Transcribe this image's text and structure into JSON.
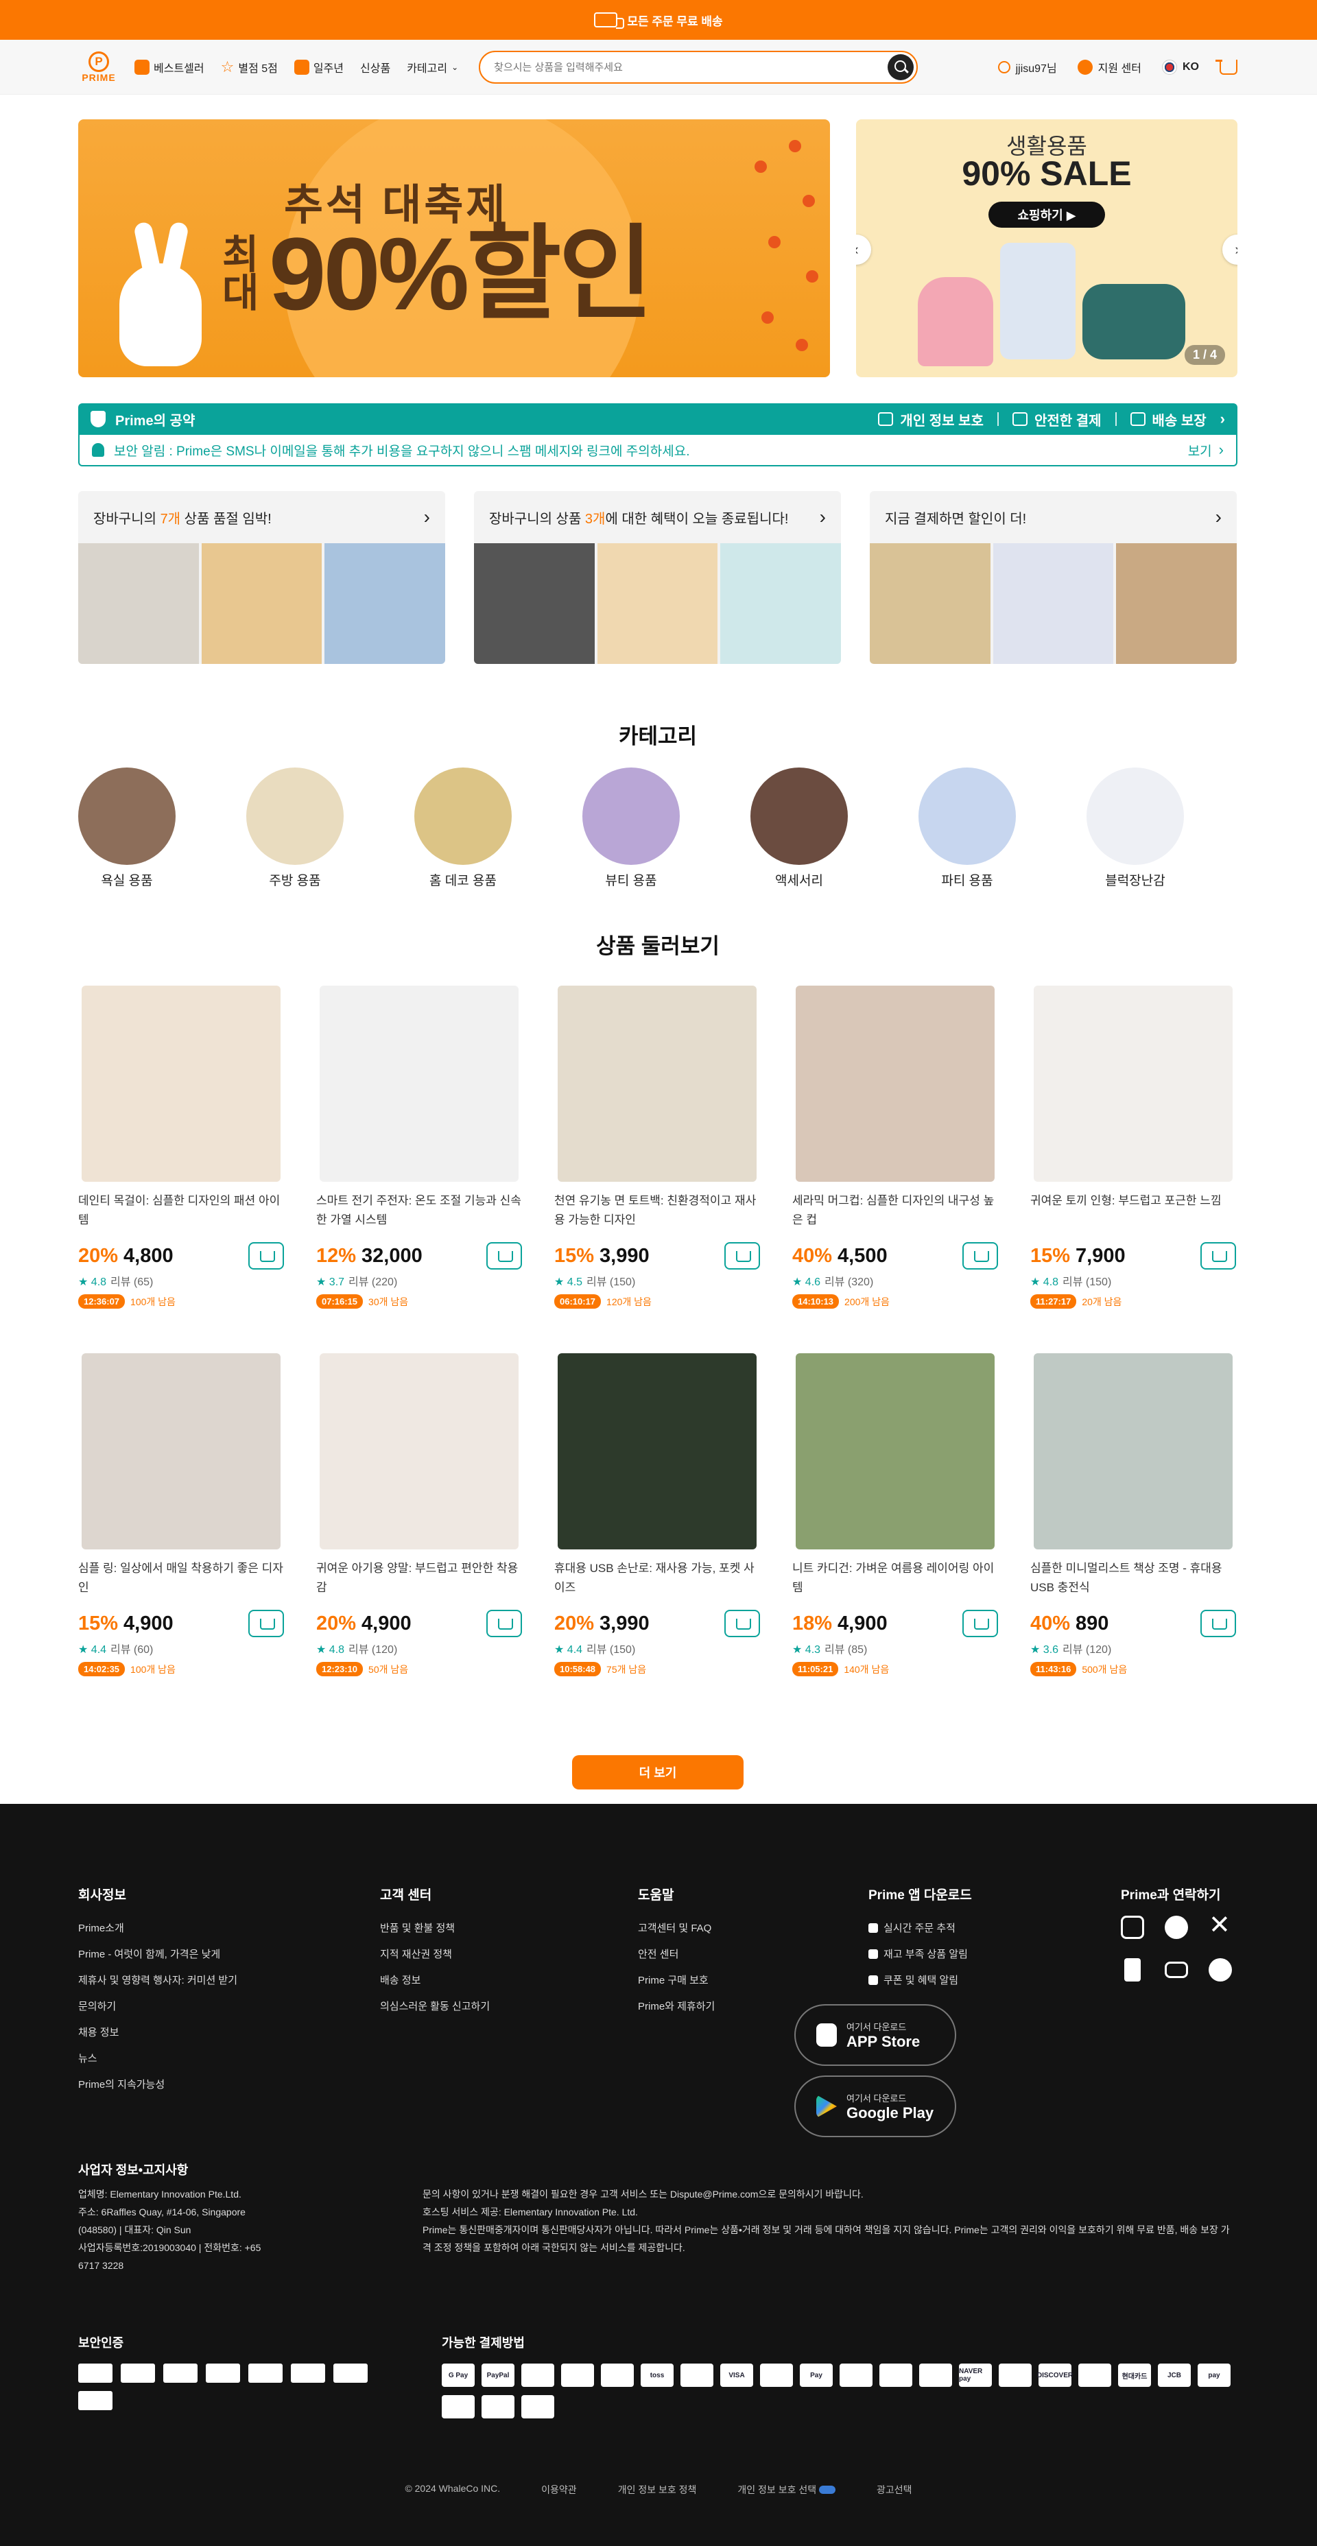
{
  "topbar": {
    "text": "모든 주문 무료 배송"
  },
  "header": {
    "logo_text": "PRIME",
    "logo_letter": "P",
    "nav": [
      {
        "label": "베스트셀러",
        "icon": "thumbs-up-icon"
      },
      {
        "label": "별점 5점",
        "icon": "star-icon"
      },
      {
        "label": "일주년",
        "icon": "store-icon"
      },
      {
        "label": "신상품"
      },
      {
        "label": "카테고리"
      }
    ],
    "search_placeholder": "찾으시는 상품을 입력해주세요",
    "user": "jjisu97님",
    "support": "지원 센터",
    "lang": "KO"
  },
  "hero": {
    "main_title": "추석 대축제",
    "main_small": "최대",
    "main_big": "90%할인",
    "side_sub": "생활용품",
    "side_title": "90% SALE",
    "side_button": "쇼핑하기 ▶",
    "pager": "1 / 4"
  },
  "promise": {
    "title": "Prime의 공약",
    "items": [
      "개인 정보 보호",
      "안전한 결제",
      "배송 보장"
    ],
    "notice": "보안 알림 : Prime은 SMS나 이메일을 통해 추가 비용을 요구하지 않으니 스팸 메세지와 링크에 주의하세요.",
    "notice_more": "보기"
  },
  "cards": [
    {
      "pre": "장바구니의 ",
      "hl": "7개",
      "post": " 상품 품절 임박!"
    },
    {
      "pre": "장바구니의 상품 ",
      "hl": "3개",
      "post": "에 대한 혜택이 오늘 종료됩니다!"
    },
    {
      "pre": "지금 결제하면 할인이 더!",
      "hl": "",
      "post": ""
    }
  ],
  "categories_title": "카테고리",
  "categories": [
    "욕실 용품",
    "주방 용품",
    "홈 데코 용품",
    "뷰티 용품",
    "액세서리",
    "파티 용품",
    "블럭장난감"
  ],
  "products_title": "상품 둘러보기",
  "products": [
    {
      "name": "데인티 목걸이: 심플한 디자인의 패션 아이템",
      "discount": "20%",
      "price": "4,800",
      "rating": "4.8",
      "reviews": "리뷰 (65)",
      "timer": "12:36:07",
      "left": "100개 남음"
    },
    {
      "name": "스마트 전기 주전자: 온도 조절 기능과 신속한 가열 시스템",
      "discount": "12%",
      "price": "32,000",
      "rating": "3.7",
      "reviews": "리뷰 (220)",
      "timer": "07:16:15",
      "left": "30개 남음"
    },
    {
      "name": "천연 유기농 면 토트백: 친환경적이고 재사용 가능한 디자인",
      "discount": "15%",
      "price": "3,990",
      "rating": "4.5",
      "reviews": "리뷰 (150)",
      "timer": "06:10:17",
      "left": "120개 남음"
    },
    {
      "name": "세라믹 머그컵: 심플한 디자인의 내구성 높은 컵",
      "discount": "40%",
      "price": "4,500",
      "rating": "4.6",
      "reviews": "리뷰 (320)",
      "timer": "14:10:13",
      "left": "200개 남음"
    },
    {
      "name": "귀여운 토끼 인형: 부드럽고 포근한 느낌",
      "discount": "15%",
      "price": "7,900",
      "rating": "4.8",
      "reviews": "리뷰 (150)",
      "timer": "11:27:17",
      "left": "20개 남음"
    },
    {
      "name": "심플 링: 일상에서 매일 착용하기 좋은 디자인",
      "discount": "15%",
      "price": "4,900",
      "rating": "4.4",
      "reviews": "리뷰 (60)",
      "timer": "14:02:35",
      "left": "100개 남음"
    },
    {
      "name": "귀여운 아기용 양말: 부드럽고 편안한 착용감",
      "discount": "20%",
      "price": "4,900",
      "rating": "4.8",
      "reviews": "리뷰 (120)",
      "timer": "12:23:10",
      "left": "50개 남음"
    },
    {
      "name": "휴대용 USB 손난로: 재사용 가능, 포켓 사이즈",
      "discount": "20%",
      "price": "3,990",
      "rating": "4.4",
      "reviews": "리뷰 (150)",
      "timer": "10:58:48",
      "left": "75개 남음"
    },
    {
      "name": "니트 카디건: 가벼운 여름용 레이어링 아이템",
      "discount": "18%",
      "price": "4,900",
      "rating": "4.3",
      "reviews": "리뷰 (85)",
      "timer": "11:05:21",
      "left": "140개 남음"
    },
    {
      "name": "심플한 미니멀리스트 책상 조명 - 휴대용 USB 충전식",
      "discount": "40%",
      "price": "890",
      "rating": "3.6",
      "reviews": "리뷰 (120)",
      "timer": "11:43:16",
      "left": "500개 남음"
    }
  ],
  "more_button": "더 보기",
  "footer": {
    "company": {
      "title": "회사정보",
      "links": [
        "Prime소개",
        "Prime - 여럿이 함께, 가격은 낮게",
        "제휴사 및 영향력 행사자: 커미션 받기",
        "문의하기",
        "채용 정보",
        "뉴스",
        "Prime의 지속가능성"
      ]
    },
    "service": {
      "title": "고객 센터",
      "links": [
        "반품 및 환불 정책",
        "지적 재산권 정책",
        "배송 정보",
        "의심스러운 활동 신고하기"
      ]
    },
    "help": {
      "title": "도움말",
      "links": [
        "고객센터 및 FAQ",
        "안전 센터",
        "Prime 구매 보호",
        "Prime와 제휴하기"
      ]
    },
    "app": {
      "title": "Prime 앱 다운로드",
      "links": [
        "실시간 주문 추적",
        "재고 부족 상품 알림",
        "쿠폰 및 혜택 알림"
      ],
      "stores": [
        {
          "small": "여기서 다운로드",
          "name": "APP Store"
        },
        {
          "small": "여기서 다운로드",
          "name": "Google Play"
        }
      ]
    },
    "contact": {
      "title": "Prime과 연락하기",
      "icons": [
        "instagram-icon",
        "facebook-icon",
        "x-icon",
        "tiktok-icon",
        "youtube-icon",
        "pinterest-icon"
      ]
    },
    "biz": {
      "title": "사업자 정보•고지사항",
      "left": [
        "업체명: Elementary Innovation Pte.Ltd.",
        "주소: 6Raffles Quay, #14-06, Singapore (048580) | 대표자: Qin Sun",
        "사업자등록번호:2019003040 | 전화번호: +65 6717 3228"
      ],
      "right": [
        "문의 사항이 있거나 분쟁 해결이 필요한 경우 고객 서비스 또는 Dispute@Prime.com으로 문의하시기 바랍니다.",
        "호스팅 서비스 제공: Elementary Innovation Pte. Ltd.",
        "Prime는 통신판매중개자이며 통신판매당사자가 아닙니다. 따라서 Prime는 상품•거래 정보 및 거래 등에 대하여 책임을 지지 않습니다. Prime는 고객의 권리와 이익을 보호하기 위해 무료 반품, 배송 보장 가격 조정 정책을 포함하여 아래 국한되지 않는 서비스를 제공합니다."
      ]
    },
    "security_title": "보안인증",
    "pay_title": "가능한 결제방법",
    "pay": [
      "G Pay",
      "PayPal",
      "",
      "",
      "",
      "toss",
      "",
      "VISA",
      "",
      "Pay",
      "",
      "",
      "",
      "NAVER pay",
      "",
      "DISCOVER",
      "",
      "현대카드",
      "JCB",
      "pay",
      "",
      "",
      ""
    ],
    "bottom": [
      "© 2024 WhaleCo INC.",
      "이용약관",
      "개인 정보 보호 정책",
      "개인 정보 보호 선택",
      "광고선택"
    ]
  },
  "colors": {
    "brand": "#fb7701",
    "teal": "#0aa39a",
    "footer": "#131313"
  }
}
